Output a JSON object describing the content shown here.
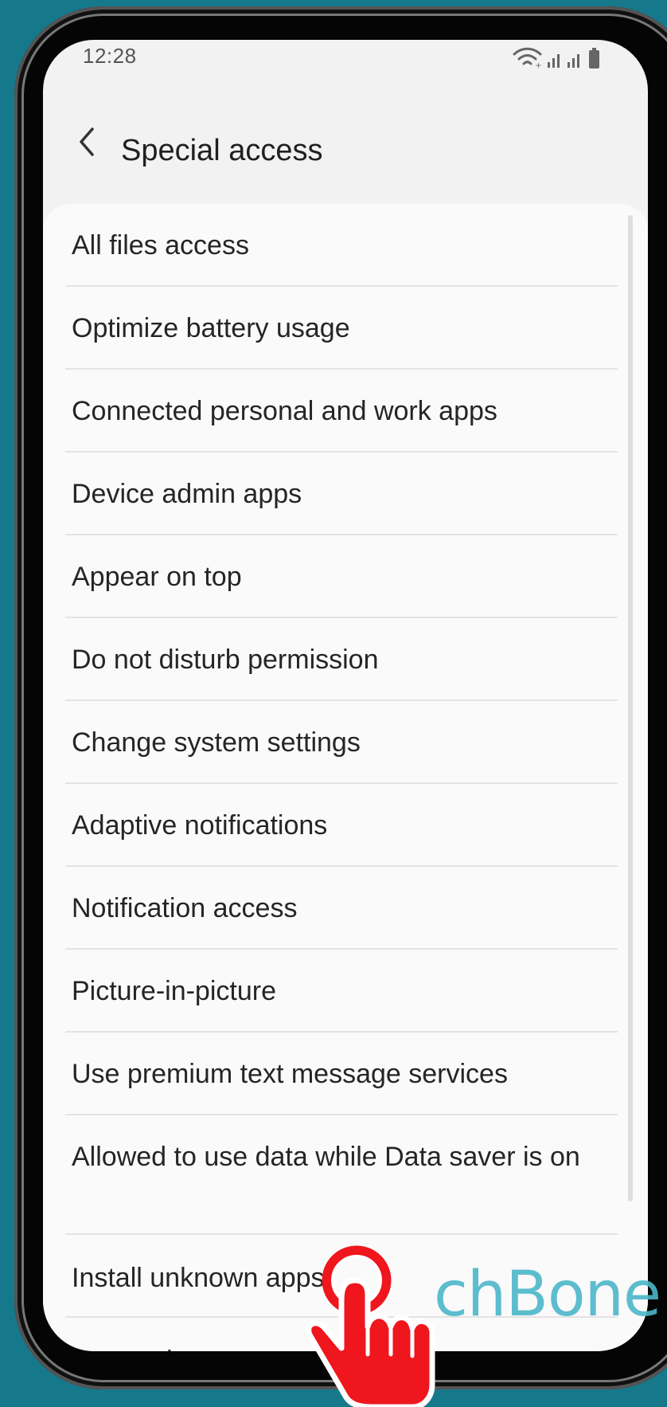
{
  "status": {
    "time": "12:28"
  },
  "header": {
    "title": "Special access"
  },
  "items": [
    "All files access",
    "Optimize battery usage",
    "Connected personal and work apps",
    "Device admin apps",
    "Appear on top",
    "Do not disturb permission",
    "Change system settings",
    "Adaptive notifications",
    "Notification access",
    "Picture-in-picture",
    "Use premium text message services",
    "Allowed to use data while Data saver is on",
    "Install unknown apps",
    "Usage data access"
  ],
  "watermark": {
    "text": "chBone"
  },
  "icons": {
    "back": "chevron-left-icon",
    "status": [
      "wifi-icon",
      "signal-icon",
      "signal-icon",
      "battery-icon"
    ],
    "tap": "tap-hand-icon"
  }
}
